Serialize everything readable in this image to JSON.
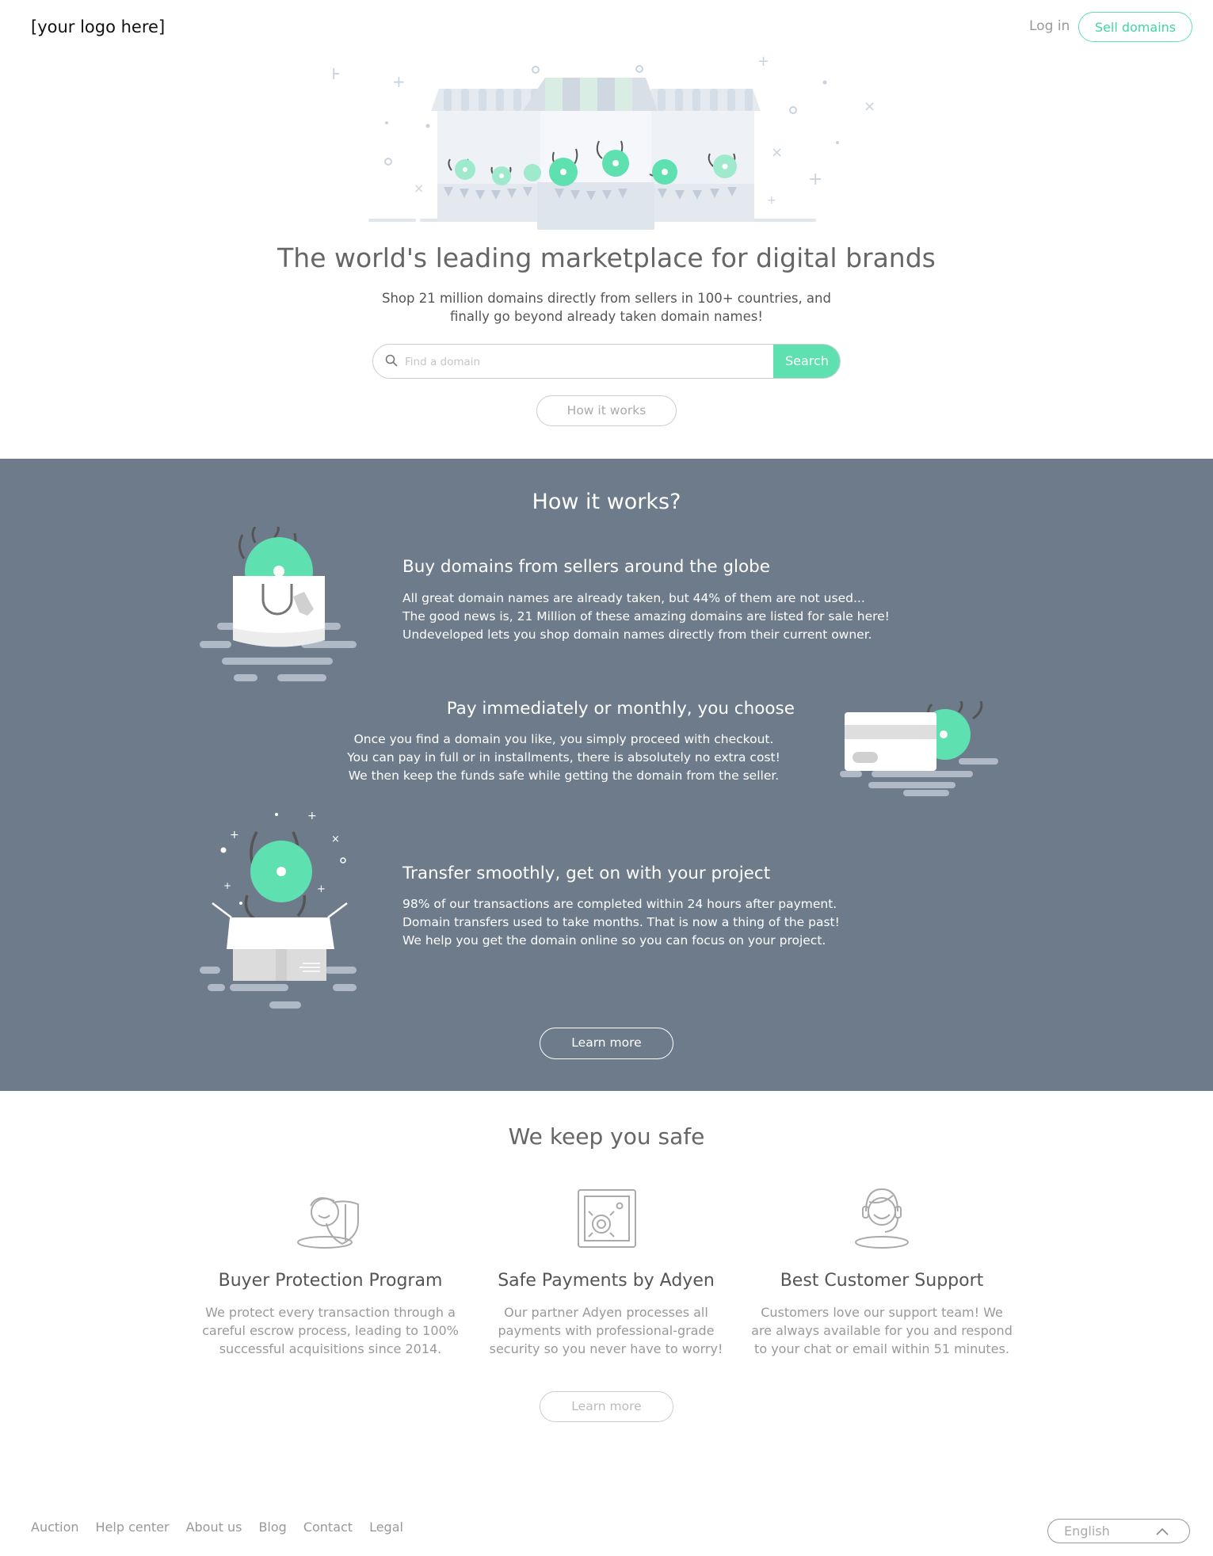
{
  "header": {
    "logo": "[your logo here]",
    "login_label": "Log in",
    "sell_label": "Sell domains"
  },
  "hero": {
    "title": "The world's leading marketplace for digital brands",
    "subtitle_line1": "Shop 21 million domains directly from sellers in 100+ countries, and",
    "subtitle_line2": "finally go beyond already taken domain names!",
    "search_placeholder": "Find a domain",
    "search_button": "Search",
    "how_button": "How it works"
  },
  "how": {
    "title": "How it works?",
    "steps": [
      {
        "heading": "Buy domains from sellers around the globe",
        "lines": [
          "All great domain names are already taken, but 44% of them are not used...",
          "The good news is, 21 Million of these amazing domains are listed for sale here!",
          "Undeveloped lets you shop domain names directly from their current owner."
        ]
      },
      {
        "heading": "Pay immediately or monthly, you choose",
        "lines": [
          "Once you find a domain you like, you simply proceed with checkout.",
          "You can pay in full or in installments, there is absolutely no extra cost!",
          "We then keep the funds safe while getting the domain from the seller."
        ]
      },
      {
        "heading": "Transfer smoothly, get on with your project",
        "lines": [
          "98% of our transactions are completed within 24 hours after payment.",
          "Domain transfers used to take months. That is now a thing of the past!",
          "We help you get the domain online so you can focus on your project."
        ]
      }
    ],
    "learn_more": "Learn more"
  },
  "safe": {
    "title": "We keep you safe",
    "features": [
      {
        "heading": "Buyer Protection Program",
        "lines": [
          "We protect every transaction through a",
          "careful escrow process, leading to 100%",
          "successful acquisitions since 2014."
        ]
      },
      {
        "heading": "Safe Payments by Adyen",
        "lines": [
          "Our partner Adyen processes all",
          "payments with professional-grade",
          "security so you never have to worry!"
        ]
      },
      {
        "heading": "Best Customer Support",
        "lines": [
          "Customers love our support team! We",
          "are always available for you and respond",
          "to your chat or email within 51 minutes."
        ]
      }
    ],
    "learn_more": "Learn more"
  },
  "footer": {
    "links": [
      "Auction",
      "Help center",
      "About us",
      "Blog",
      "Contact",
      "Legal"
    ],
    "language": "English"
  },
  "colors": {
    "accent": "#5ee0b1",
    "section_bg": "#6e7b8b"
  }
}
